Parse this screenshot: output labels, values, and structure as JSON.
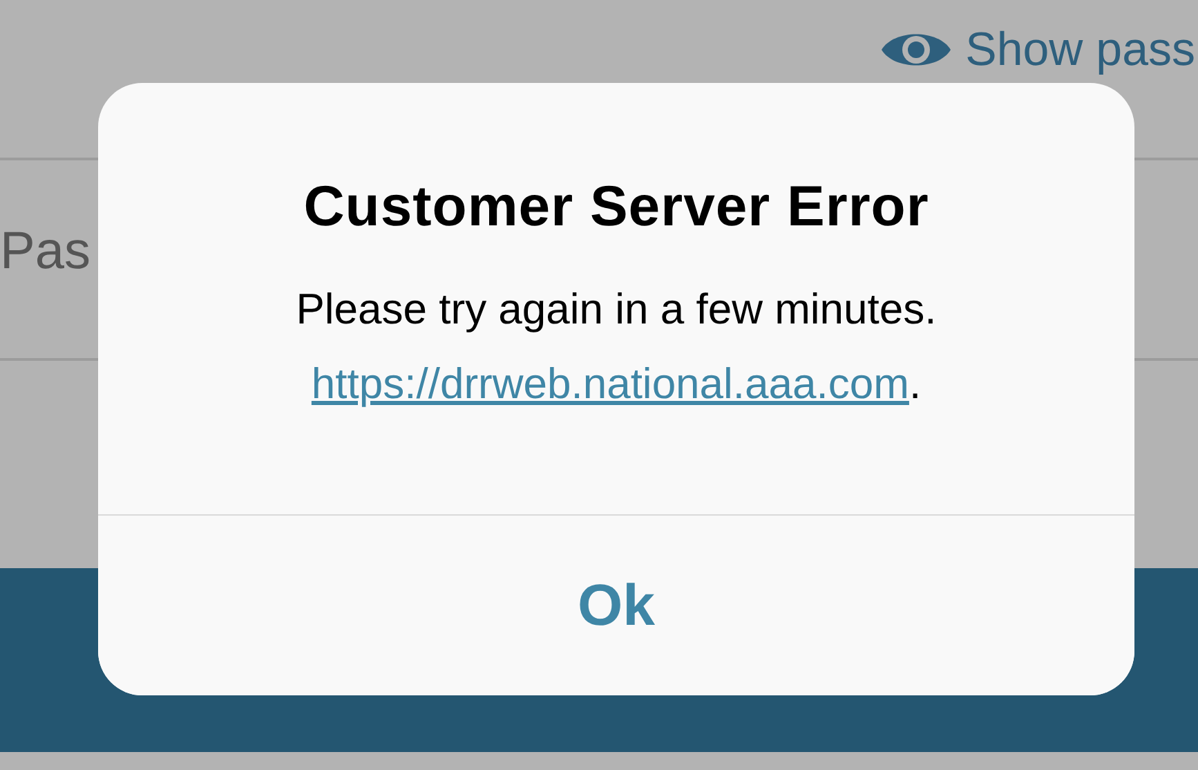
{
  "background": {
    "show_password": "Show pass",
    "password_label": "Pas"
  },
  "dialog": {
    "title": "Customer Server Error",
    "message": "Please try again in a few minutes.",
    "link": "https://drrweb.national.aaa.com",
    "message_end": ".",
    "buttons": [
      "Ok"
    ]
  }
}
